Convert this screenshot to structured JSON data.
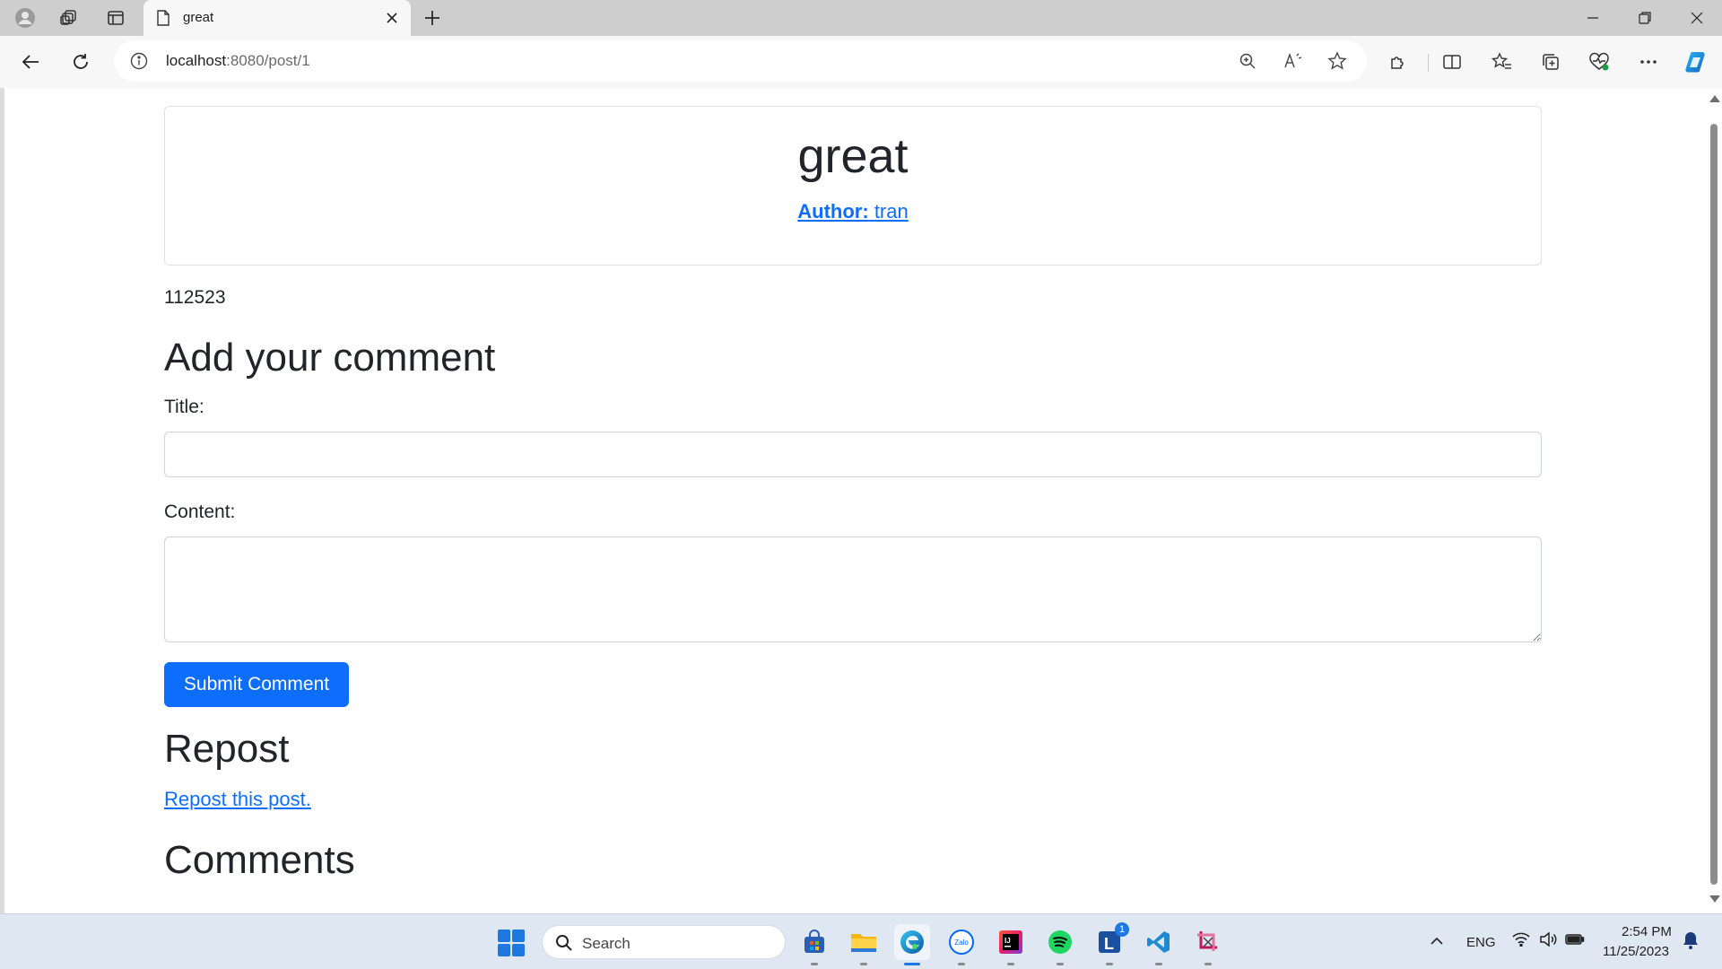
{
  "browser": {
    "tab_title": "great",
    "url_host": "localhost",
    "url_rest": ":8080/post/1"
  },
  "post": {
    "title": "great",
    "author_label": "Author:",
    "author_name": "tran",
    "content": "112523"
  },
  "comment_form": {
    "heading": "Add your comment",
    "title_label": "Title:",
    "title_value": "",
    "content_label": "Content:",
    "content_value": "",
    "submit_label": "Submit Comment"
  },
  "repost": {
    "heading": "Repost",
    "link_text": "Repost this post."
  },
  "comments": {
    "heading": "Comments"
  },
  "taskbar": {
    "search_placeholder": "Search",
    "language": "ENG",
    "time": "2:54 PM",
    "date": "11/25/2023",
    "badge_count": "1",
    "apps": [
      "store-icon",
      "file-explorer-icon",
      "edge-icon",
      "zalo-icon",
      "intellij-icon",
      "spotify-icon",
      "lightshot-icon",
      "vscode-icon",
      "snipping-tool-icon"
    ]
  },
  "colors": {
    "link": "#0d6efd",
    "button": "#0d6efd",
    "text": "#212529",
    "border": "#dee2e6"
  }
}
